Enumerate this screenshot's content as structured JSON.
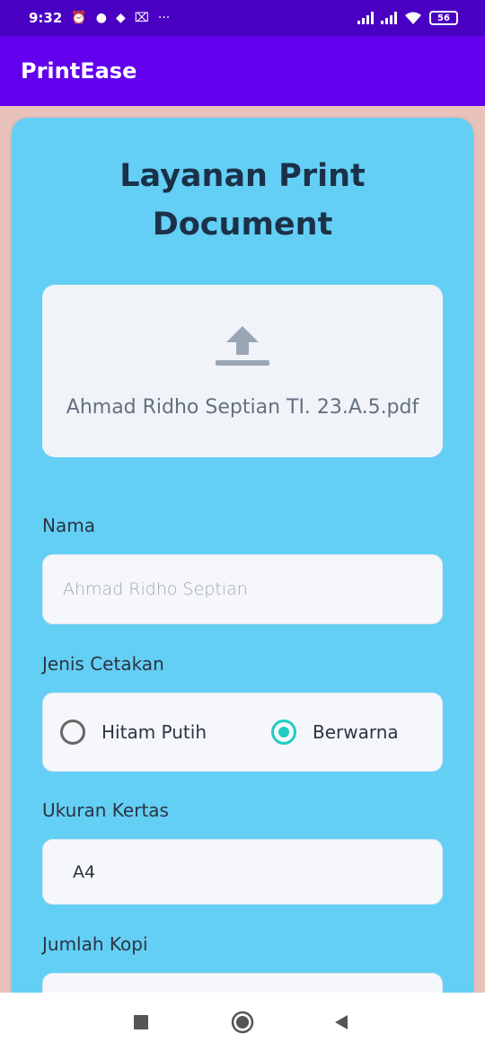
{
  "status_bar": {
    "time": "9:32",
    "notification_icons": [
      "alarm-icon",
      "chat-icon",
      "dropbox-icon",
      "capcut-icon",
      "more-icon"
    ],
    "battery": "56"
  },
  "app_bar": {
    "title": "PrintEase"
  },
  "form": {
    "title_line1": "Layanan Print",
    "title_line2": "Document",
    "upload": {
      "file_name": "Ahmad Ridho Septian TI. 23.A.5.pdf"
    },
    "nama": {
      "label": "Nama",
      "placeholder": "Ahmad Ridho Septian"
    },
    "jenis_cetakan": {
      "label": "Jenis Cetakan",
      "options": [
        {
          "label": "Hitam Putih",
          "selected": false
        },
        {
          "label": "Berwarna",
          "selected": true
        }
      ]
    },
    "ukuran_kertas": {
      "label": "Ukuran Kertas",
      "value": "A4"
    },
    "jumlah_kopi": {
      "label": "Jumlah Kopi"
    }
  },
  "colors": {
    "status_bar": "#4a00c2",
    "app_bar": "#6200ee",
    "background": "#e8c2bb",
    "card": "#64cff5",
    "radio_accent": "#1ecdc2"
  }
}
